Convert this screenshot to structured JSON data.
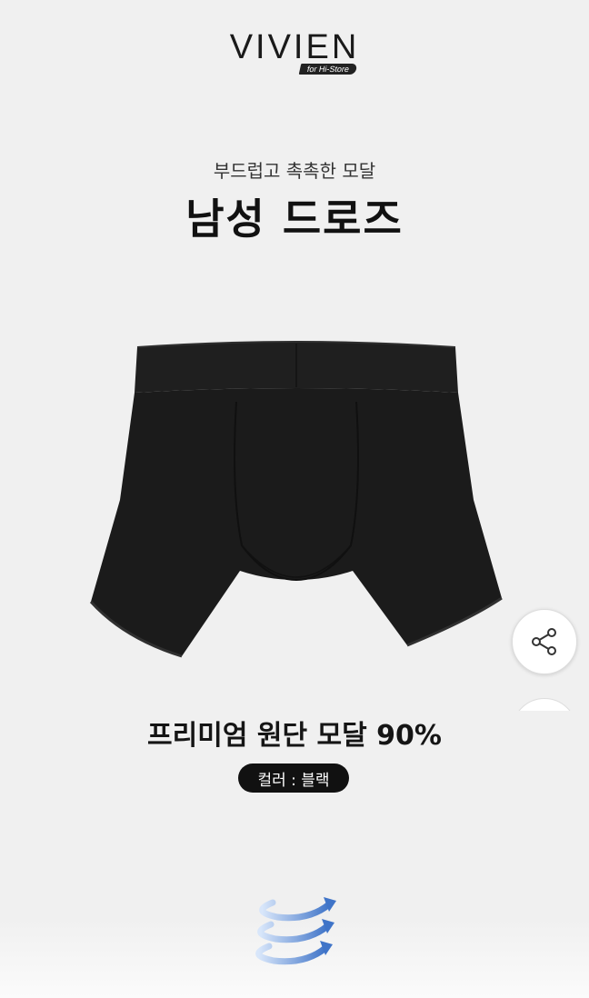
{
  "brand": {
    "name": "VIVIEN",
    "tagline": "for Hi-Store"
  },
  "hero": {
    "subtitle": "부드럽고 촉촉한 모달",
    "title": "남성 드로즈"
  },
  "product": {
    "image_alt": "black men's trunks"
  },
  "feature": {
    "text": "프리미엄 원단 모달 90%",
    "color_badge": "컬러 : 블랙"
  },
  "actions": {
    "share_icon": "share-icon"
  },
  "colors": {
    "background": "#f0f0f0",
    "badge": "#111111",
    "garment": "#1c1c1c",
    "swirl": "#4a7fd0"
  }
}
